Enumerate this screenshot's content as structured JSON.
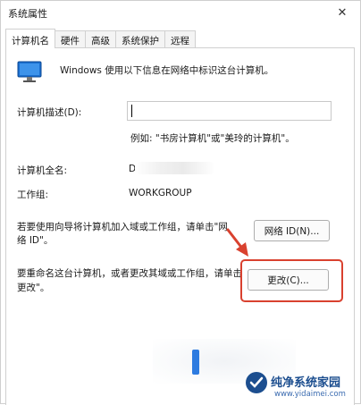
{
  "window": {
    "title": "系统属性",
    "close_glyph": "✕"
  },
  "tabs": [
    {
      "label": "计算机名",
      "active": true
    },
    {
      "label": "硬件",
      "active": false
    },
    {
      "label": "高级",
      "active": false
    },
    {
      "label": "系统保护",
      "active": false
    },
    {
      "label": "远程",
      "active": false
    }
  ],
  "info": {
    "text": "Windows 使用以下信息在网络中标识这台计算机。",
    "icon": "monitor-icon"
  },
  "description": {
    "label": "计算机描述(D):",
    "value": "",
    "example": "例如: \"书房计算机\"或\"美玲的计算机\"。"
  },
  "full_name": {
    "label": "计算机全名:",
    "value": "D"
  },
  "workgroup": {
    "label": "工作组:",
    "value": "WORKGROUP"
  },
  "network_id": {
    "text_line1": "若要使用向导将计算机加入域或工作组，请单击\"网",
    "text_line2": "络 ID\"。",
    "button_label": "网络 ID(N)..."
  },
  "rename": {
    "text_line1": "要重命名这台计算机，或者更改其域或工作组，请单击",
    "text_line2": "更改\"。",
    "button_label": "更改(C)..."
  },
  "colors": {
    "highlight": "#d9412f",
    "watermark": "#1c4e8f"
  },
  "watermark": {
    "name": "纯净系统家园",
    "url": "www.yidaimei.com"
  }
}
